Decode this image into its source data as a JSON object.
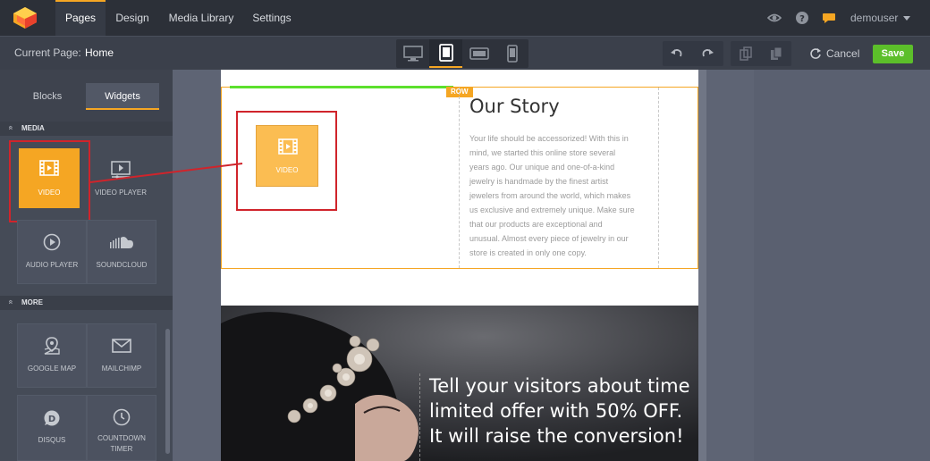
{
  "topbar": {
    "tabs": [
      {
        "label": "Pages",
        "active": true
      },
      {
        "label": "Design",
        "active": false
      },
      {
        "label": "Media Library",
        "active": false
      },
      {
        "label": "Settings",
        "active": false
      }
    ],
    "user": "demouser"
  },
  "toolbar": {
    "current_page_label": "Current Page:",
    "current_page_value": "Home",
    "cancel_label": "Cancel",
    "save_label": "Save"
  },
  "sidebar": {
    "tabs": [
      {
        "label": "Blocks",
        "active": false
      },
      {
        "label": "Widgets",
        "active": true
      }
    ],
    "sections": [
      {
        "title": "MEDIA",
        "widgets": [
          {
            "label": "VIDEO",
            "icon": "film-icon",
            "selected": true
          },
          {
            "label": "VIDEO PLAYER",
            "icon": "video-player-icon",
            "selected": false
          },
          {
            "label": "AUDIO PLAYER",
            "icon": "play-circle-icon",
            "selected": false
          },
          {
            "label": "SOUNDCLOUD",
            "icon": "soundcloud-icon",
            "selected": false
          }
        ]
      },
      {
        "title": "MORE",
        "widgets": [
          {
            "label": "GOOGLE MAP",
            "icon": "map-pin-icon",
            "selected": false
          },
          {
            "label": "MAILCHIMP",
            "icon": "envelope-icon",
            "selected": false
          },
          {
            "label": "DISQUS",
            "icon": "disqus-icon",
            "selected": false
          },
          {
            "label": "COUNTDOWN TIMER",
            "icon": "clock-icon",
            "selected": false
          }
        ]
      }
    ]
  },
  "canvas": {
    "row_tag": "ROW",
    "video_widget_label": "VIDEO",
    "story": {
      "title": "Our Story",
      "lines": [
        "Your life should be accessorized! With this in",
        "mind, we started this online store several",
        "years ago. Our unique and one-of-a-kind",
        "jewelry is handmade by the finest artist",
        "jewelers from around the world, which makes",
        "us exclusive and extremely unique. Make sure",
        "that our products are exceptional and",
        "unusual. Almost every piece of jewelry in our",
        "store is created in only one copy."
      ]
    },
    "hero": {
      "lines": [
        "Tell your visitors about time",
        "limited offer with 50% OFF.",
        "It will raise the conversion!"
      ]
    }
  },
  "colors": {
    "accent": "#f5a623",
    "save": "#5cbf2a",
    "annotation": "#d0242b"
  }
}
